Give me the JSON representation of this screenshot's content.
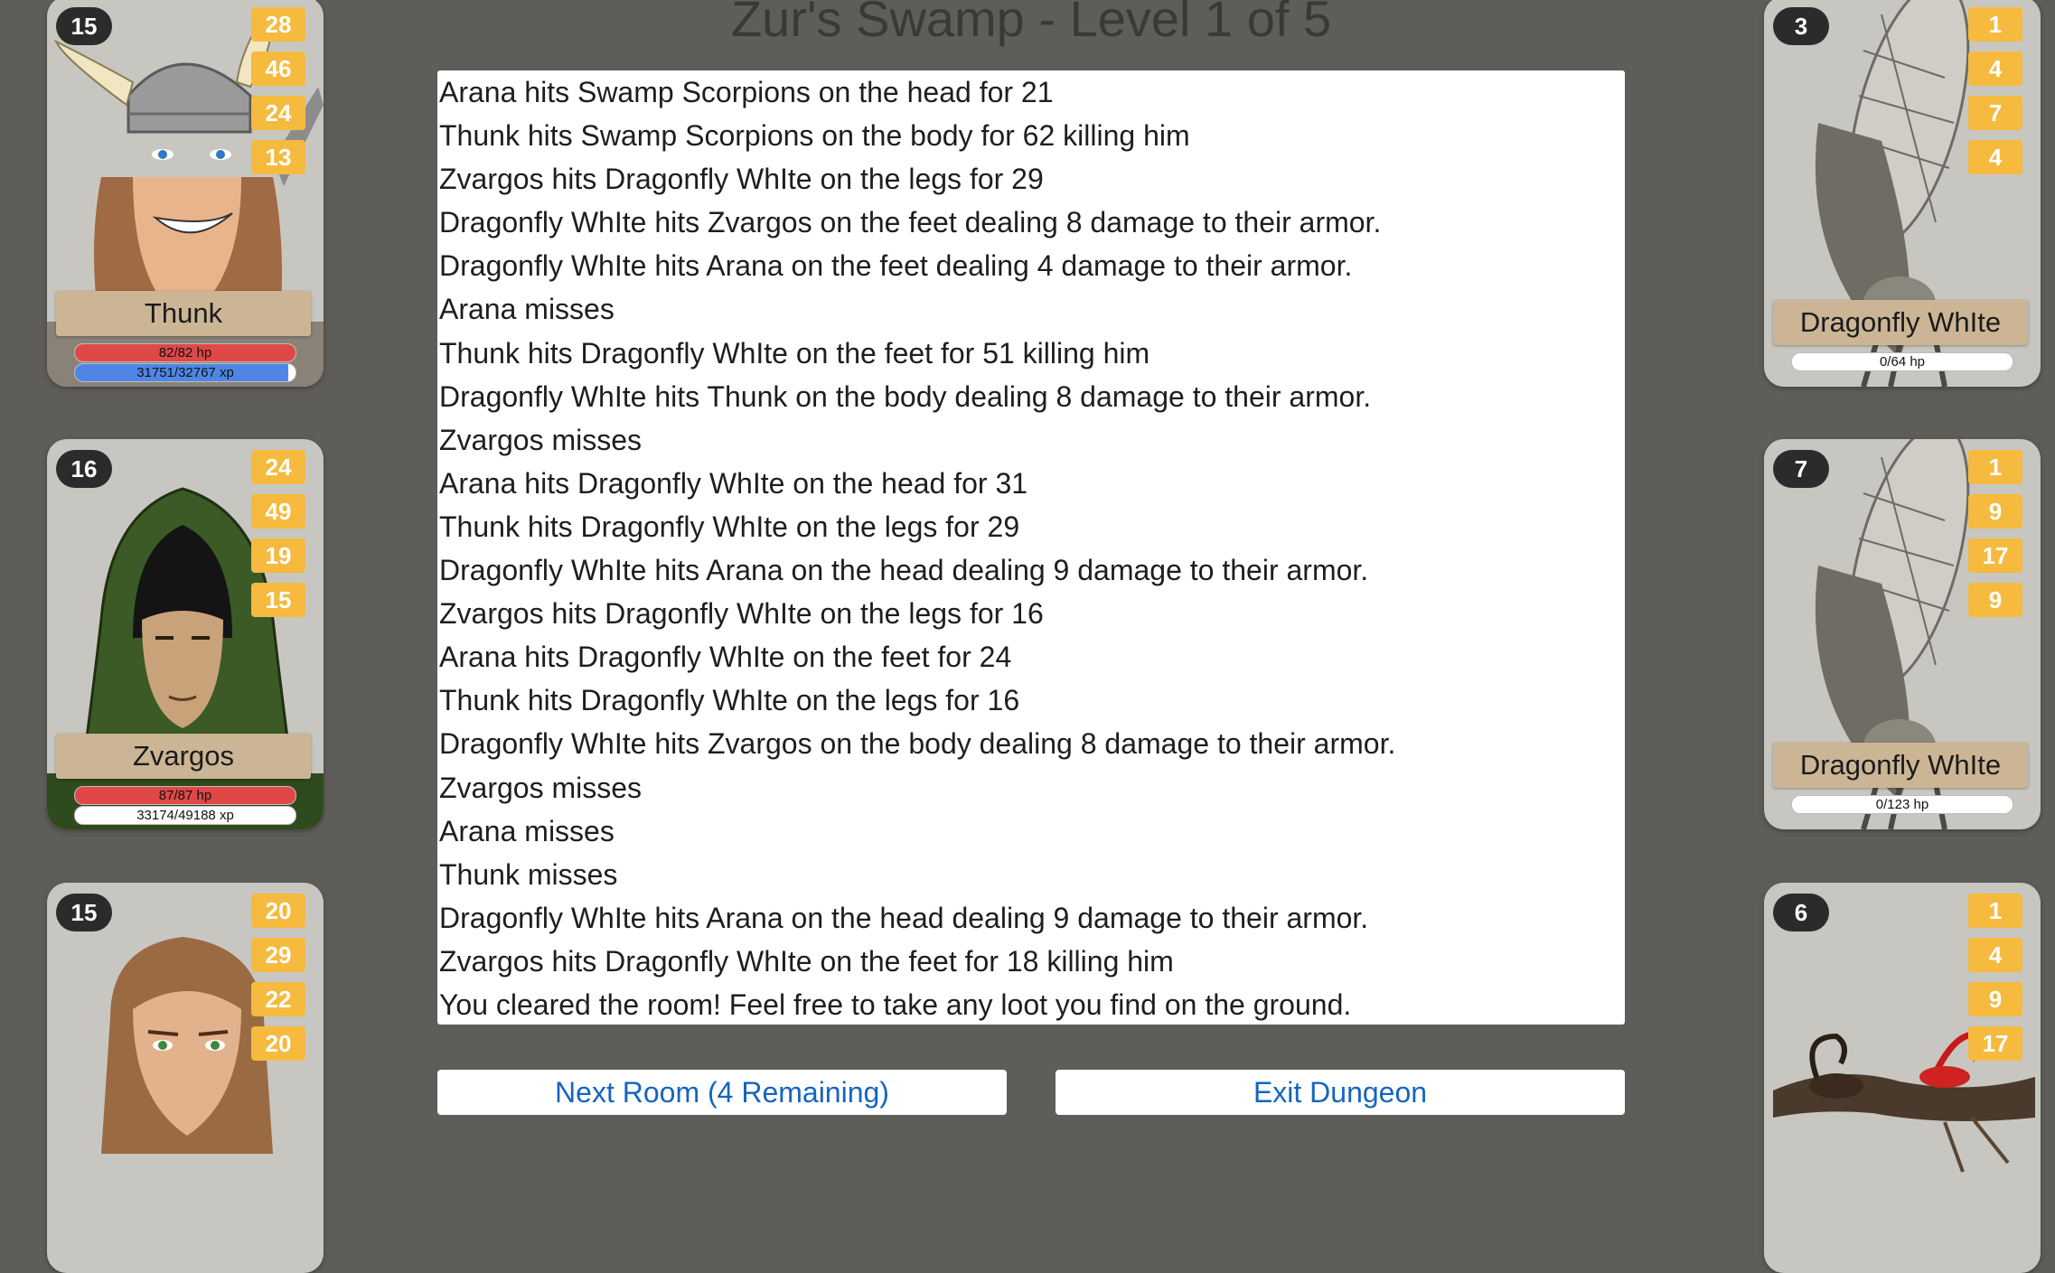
{
  "header": {
    "title": "Zur's Swamp - Level 1 of 5"
  },
  "party": [
    {
      "name": "Thunk",
      "level": "15",
      "stats": [
        "28",
        "46",
        "24",
        "13"
      ],
      "hp": "82/82 hp",
      "hp_fraction": 1.0,
      "xp": "31751/32767 xp",
      "xp_fraction": 0.969
    },
    {
      "name": "Zvargos",
      "level": "16",
      "stats": [
        "24",
        "49",
        "19",
        "15"
      ],
      "hp": "87/87 hp",
      "hp_fraction": 1.0,
      "xp": "33174/49188 xp",
      "xp_fraction": 0.0
    },
    {
      "level": "15",
      "stats": [
        "20",
        "29",
        "22",
        "20"
      ]
    }
  ],
  "enemies": [
    {
      "name": "Dragonfly WhIte",
      "level": "3",
      "stats": [
        "1",
        "4",
        "7",
        "4"
      ],
      "hp": "0/64 hp",
      "hp_fraction": 0.0
    },
    {
      "name": "Dragonfly WhIte",
      "level": "7",
      "stats": [
        "1",
        "9",
        "17",
        "9"
      ],
      "hp": "0/123 hp",
      "hp_fraction": 0.0
    },
    {
      "level": "6",
      "stats": [
        "1",
        "4",
        "9",
        "17"
      ]
    }
  ],
  "combat_log": [
    "Arana hits Swamp Scorpions on the head for 21",
    "Thunk hits Swamp Scorpions on the body for 62 killing him",
    "Zvargos hits Dragonfly WhIte on the legs for 29",
    "Dragonfly WhIte hits Zvargos on the feet dealing 8 damage to their armor.",
    "Dragonfly WhIte hits Arana on the feet dealing 4 damage to their armor.",
    "Arana misses",
    "Thunk hits Dragonfly WhIte on the feet for 51 killing him",
    "Dragonfly WhIte hits Thunk on the body dealing 8 damage to their armor.",
    "Zvargos misses",
    "Arana hits Dragonfly WhIte on the head for 31",
    "Thunk hits Dragonfly WhIte on the legs for 29",
    "Dragonfly WhIte hits Arana on the head dealing 9 damage to their armor.",
    "Zvargos hits Dragonfly WhIte on the legs for 16",
    "Arana hits Dragonfly WhIte on the feet for 24",
    "Thunk hits Dragonfly WhIte on the legs for 16",
    "Dragonfly WhIte hits Zvargos on the body dealing 8 damage to their armor.",
    "Zvargos misses",
    "Arana misses",
    "Thunk misses",
    "Dragonfly WhIte hits Arana on the head dealing 9 damage to their armor.",
    "Zvargos hits Dragonfly WhIte on the feet for 18 killing him",
    "You cleared the room! Feel free to take any loot you find on the ground."
  ],
  "actions": {
    "next_room_label": "Next Room (4 Remaining)",
    "exit_label": "Exit Dungeon"
  },
  "colors": {
    "background": "#5e5d59",
    "stat_badge": "#f5ba3e",
    "hp_bar": "#e04848",
    "xp_bar": "#4f86e6",
    "nameplate": "#cbb595",
    "link": "#1565c0"
  }
}
